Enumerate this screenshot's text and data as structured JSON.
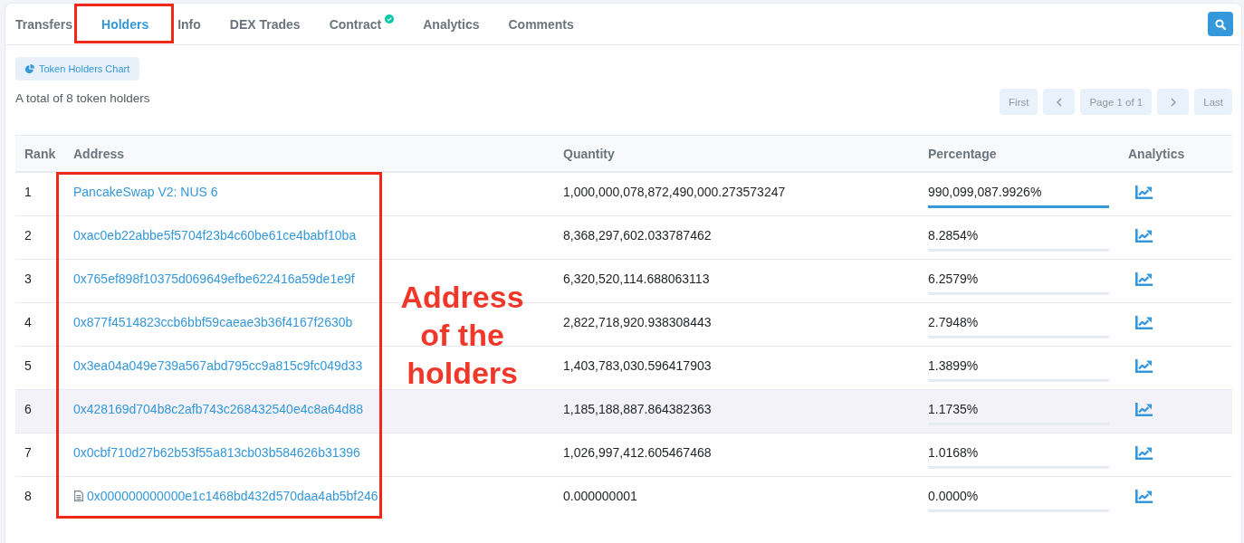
{
  "tabs": [
    {
      "label": "Transfers",
      "selected": false,
      "highlighted": false,
      "verified": false
    },
    {
      "label": "Holders",
      "selected": true,
      "highlighted": true,
      "verified": false
    },
    {
      "label": "Info",
      "selected": false,
      "highlighted": false,
      "verified": false
    },
    {
      "label": "DEX Trades",
      "selected": false,
      "highlighted": false,
      "verified": false
    },
    {
      "label": "Contract",
      "selected": false,
      "highlighted": false,
      "verified": true
    },
    {
      "label": "Analytics",
      "selected": false,
      "highlighted": false,
      "verified": false
    },
    {
      "label": "Comments",
      "selected": false,
      "highlighted": false,
      "verified": false
    }
  ],
  "chart_button": {
    "label": "Token Holders Chart"
  },
  "summary": "A total of 8 token holders",
  "pagination": {
    "first": "First",
    "page": "Page 1 of 1",
    "last": "Last"
  },
  "table": {
    "columns": [
      {
        "label": "Rank",
        "highlighted": false
      },
      {
        "label": "Address",
        "highlighted": true
      },
      {
        "label": "Quantity",
        "highlighted": false
      },
      {
        "label": "Percentage",
        "highlighted": false
      },
      {
        "label": "Analytics",
        "highlighted": false
      }
    ],
    "rows": [
      {
        "rank": "1",
        "kind": "address",
        "address": "PancakeSwap V2: NUS 6",
        "quantity": "1,000,000,078,872,490,000.273573247",
        "percentage": "990,099,087.9926%",
        "level": 1,
        "hovered": false
      },
      {
        "rank": "2",
        "kind": "address",
        "address": "0xac0eb22abbe5f5704f23b4c60be61ce4babf10ba",
        "quantity": "8,368,297,602.033787462",
        "percentage": "8.2854%",
        "hovered": false
      },
      {
        "rank": "3",
        "kind": "address",
        "address": "0x765ef898f10375d069649efbe622416a59de1e9f",
        "quantity": "6,320,520,114.688063113",
        "percentage": "6.2579%",
        "hovered": false
      },
      {
        "rank": "4",
        "kind": "address",
        "address": "0x877f4514823ccb6bbf59caeae3b36f4167f2630b",
        "quantity": "2,822,718,920.938308443",
        "percentage": "2.7948%",
        "hovered": false
      },
      {
        "rank": "5",
        "kind": "address",
        "address": "0x3ea04a049e739a567abd795cc9a815c9fc049d33",
        "quantity": "1,403,783,030.596417903",
        "percentage": "1.3899%",
        "hovered": false
      },
      {
        "rank": "6",
        "kind": "address",
        "address": "0x428169d704b8c2afb743c268432540e4c8a64d88",
        "quantity": "1,185,188,887.864382363",
        "percentage": "1.1735%",
        "hovered": true
      },
      {
        "rank": "7",
        "kind": "address",
        "address": "0x0cbf710d27b62b53f55a813cb03b584626b31396",
        "quantity": "1,026,997,412.605467468",
        "percentage": "1.0168%",
        "hovered": false
      },
      {
        "rank": "8",
        "kind": "contract",
        "address": "0x000000000000e1c1468bd432d570daa4ab5bf246",
        "quantity": "0.000000001",
        "percentage": "0.0000%",
        "hovered": false
      }
    ]
  },
  "annotation": {
    "label": "Address of the holders"
  }
}
